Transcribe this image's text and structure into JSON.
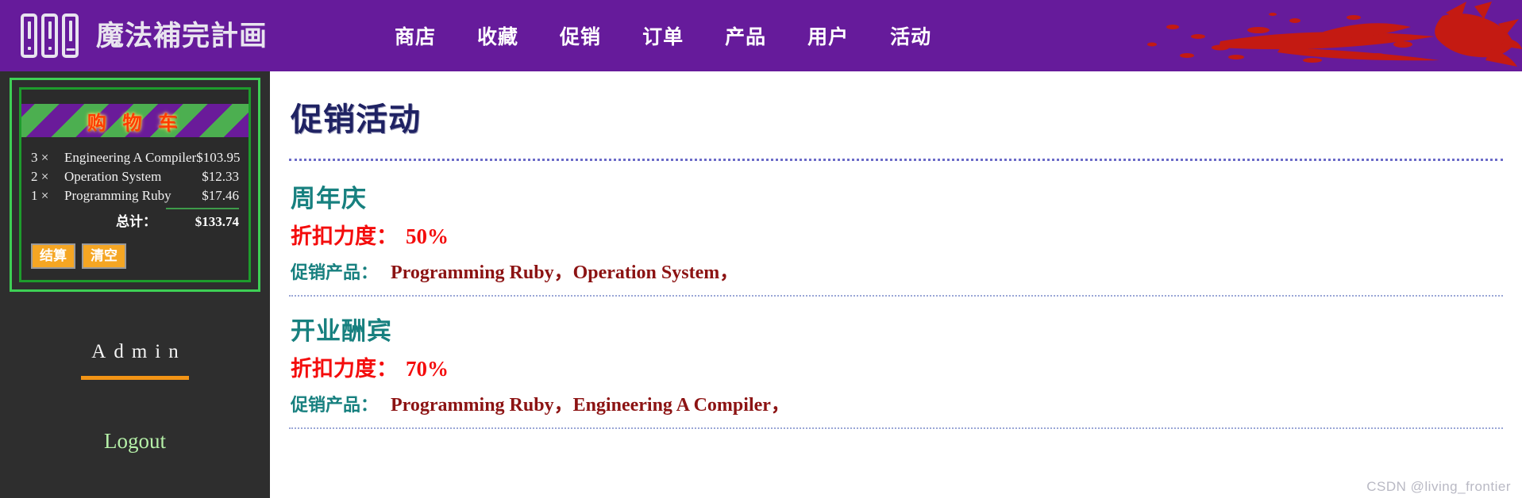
{
  "header": {
    "logo_icon": "three-books-icon",
    "brand_title": "魔法補完計画",
    "nav": [
      {
        "label": "商店"
      },
      {
        "label": "收藏"
      },
      {
        "label": "促销"
      },
      {
        "label": "订单"
      },
      {
        "label": "产品"
      },
      {
        "label": "用户"
      },
      {
        "label": "活动"
      }
    ],
    "background_color": "#661b9b",
    "splatter_color": "#c41a12"
  },
  "sidebar": {
    "cart": {
      "title": "购 物 车",
      "items": [
        {
          "qty": "3 ×",
          "name": "Engineering A Compiler",
          "price": "$103.95"
        },
        {
          "qty": "2 ×",
          "name": "Operation System",
          "price": "$12.33"
        },
        {
          "qty": "1 ×",
          "name": "Programming Ruby",
          "price": "$17.46"
        }
      ],
      "total_label": "总计：",
      "total_value": "$133.74",
      "checkout_label": "结算",
      "clear_label": "清空"
    },
    "user": {
      "name": "Admin",
      "logout_label": "Logout"
    }
  },
  "main": {
    "page_title": "促销活动",
    "promotions": [
      {
        "name": "周年庆",
        "discount_label": "折扣力度：",
        "discount_value": "50%",
        "products_label": "促销产品：",
        "products_list": "Programming Ruby，Operation System，"
      },
      {
        "name": "开业酬宾",
        "discount_label": "折扣力度：",
        "discount_value": "70%",
        "products_label": "促销产品：",
        "products_list": "Programming Ruby，Engineering A Compiler，"
      }
    ]
  },
  "watermark": {
    "text": "CSDN @living_frontier"
  }
}
